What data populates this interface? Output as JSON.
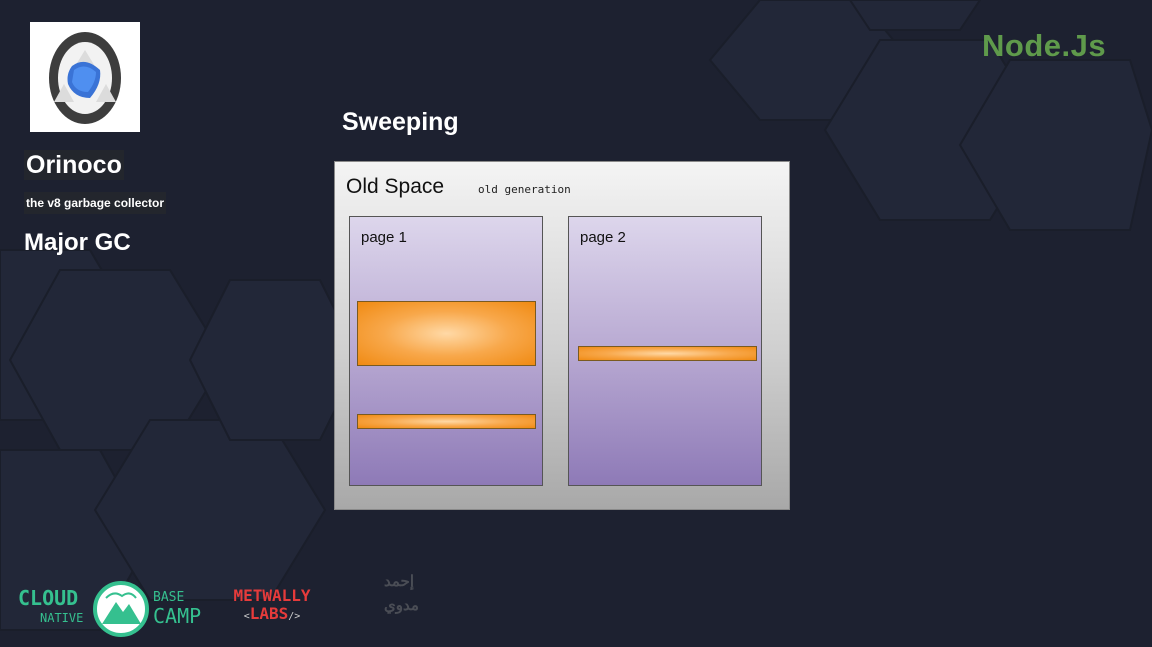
{
  "sidebar": {
    "title": "Orinoco",
    "subtitle": "the v8 garbage collector",
    "section": "Major GC"
  },
  "brand": {
    "name": "Node.Js"
  },
  "slide": {
    "title": "Sweeping",
    "old_space": {
      "label": "Old Space",
      "sublabel": "old generation",
      "pages": [
        {
          "label": "page 1"
        },
        {
          "label": "page 2"
        }
      ]
    }
  },
  "footer": {
    "cloud_native": {
      "line1": "CLOUD",
      "line2": "NATIVE",
      "line3": "BASE",
      "line4": "CAMP"
    },
    "metwally": {
      "line1": "METWALLY",
      "line2": "LABS"
    },
    "signature": {
      "line1": "إحمد",
      "line2": "مدوي"
    }
  },
  "colors": {
    "background": "#1d2130",
    "brand": "#5f9a4b",
    "object": "#f08a12",
    "page": "#8e7ab7",
    "cloud_accent": "#35c08f",
    "metwally_red": "#e63b3b"
  },
  "icons": {
    "logo": "recycle-icon"
  }
}
